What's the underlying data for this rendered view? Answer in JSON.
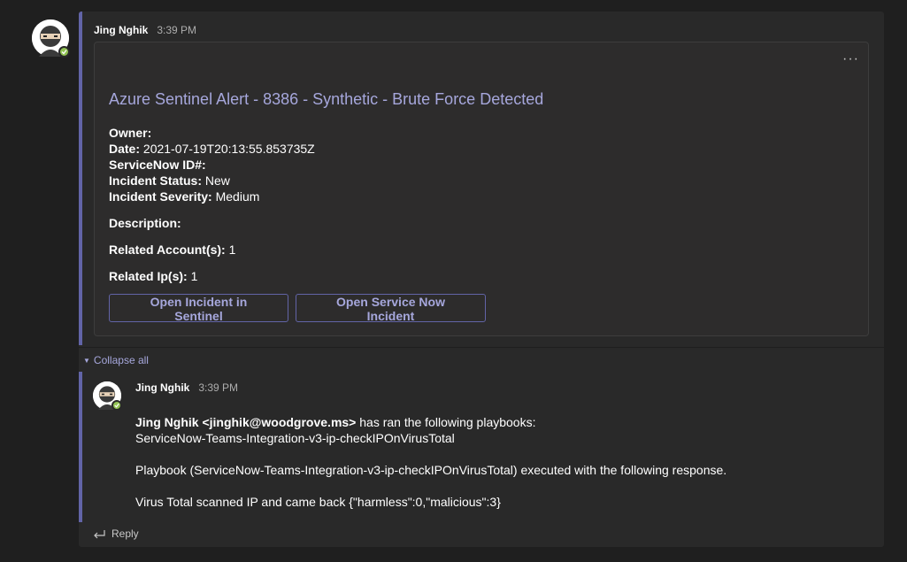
{
  "main_message": {
    "author": "Jing Nghik",
    "time": "3:39 PM",
    "card": {
      "title": "Azure Sentinel Alert - 8386 - Synthetic - Brute Force Detected",
      "more_label": "···",
      "facts": [
        {
          "label": "Owner:",
          "value": ""
        },
        {
          "label": "Date:",
          "value": " 2021-07-19T20:13:55.853735Z"
        },
        {
          "label": "ServiceNow ID#:",
          "value": ""
        },
        {
          "label": "Incident Status:",
          "value": " New"
        },
        {
          "label": "Incident Severity:",
          "value": " Medium"
        }
      ],
      "description_label": "Description:",
      "related_accounts_label": "Related Account(s):",
      "related_accounts_value": " 1",
      "related_ips_label": "Related Ip(s):",
      "related_ips_value": " 1",
      "buttons": [
        "Open Incident in Sentinel",
        "Open Service Now Incident"
      ]
    }
  },
  "collapse_label": "Collapse all",
  "reply_message": {
    "author": "Jing Nghik",
    "time": "3:39 PM",
    "mention": "Jing Nghik <jinghik@woodgrove.ms>",
    "line1_rest": " has ran the following playbooks:",
    "line2": "ServiceNow-Teams-Integration-v3-ip-checkIPOnVirusTotal",
    "line3": "Playbook (ServiceNow-Teams-Integration-v3-ip-checkIPOnVirusTotal) executed with the following response.",
    "line4": "Virus Total scanned IP and came back {\"harmless\":0,\"malicious\":3}"
  },
  "reply_label": "Reply",
  "icons": {
    "avatar": "ninja-avatar-icon",
    "presence": "available-status-icon",
    "collapse": "caret-down-icon",
    "reply": "reply-arrow-icon"
  },
  "colors": {
    "accent": "#6264a7",
    "accent_text": "#a6a7dc",
    "presence": "#92c353",
    "background": "#1f1f1f"
  }
}
